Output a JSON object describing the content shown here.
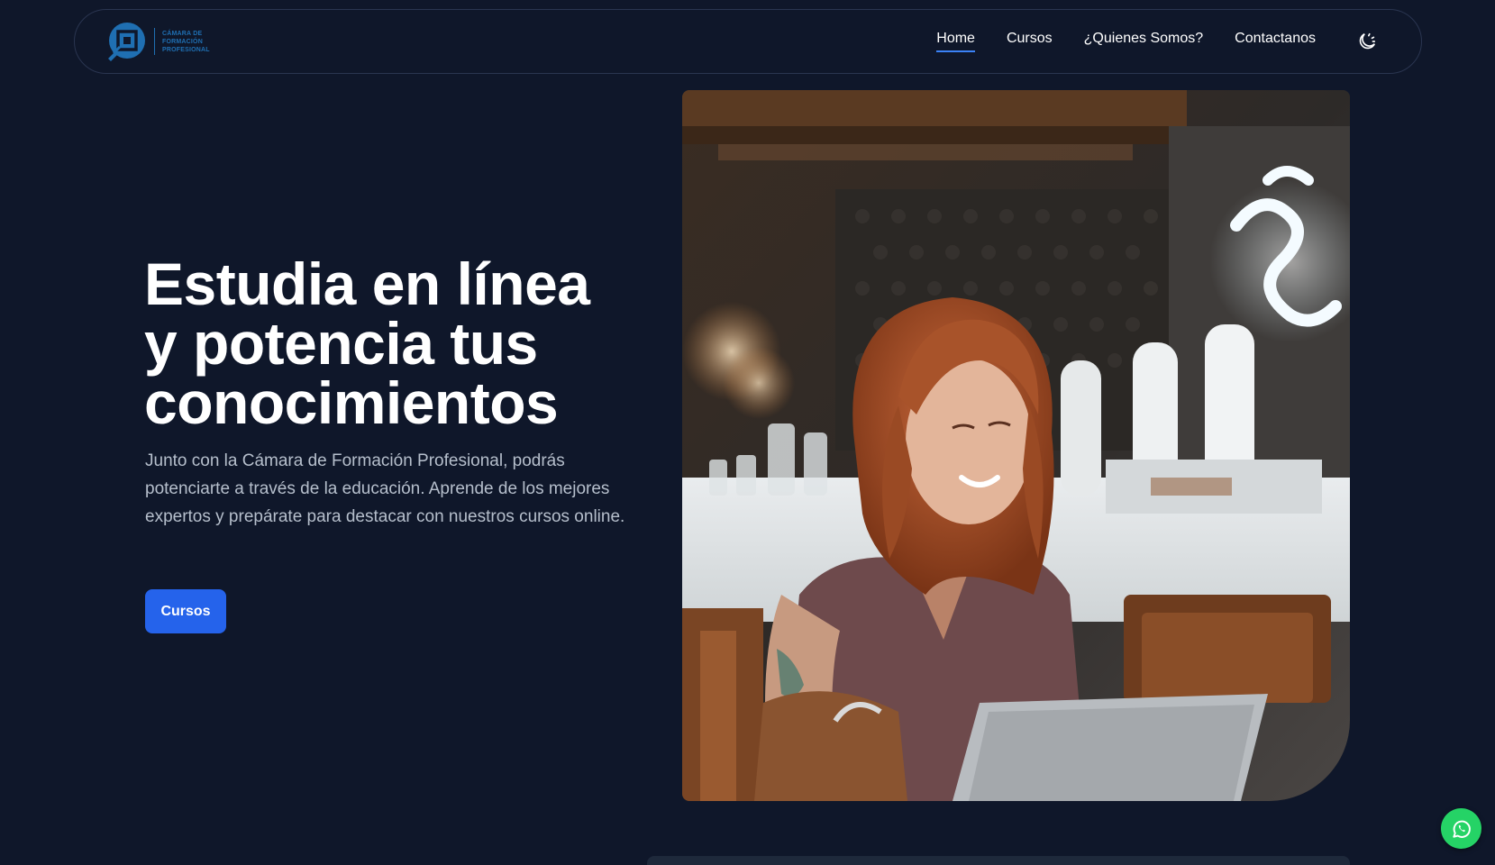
{
  "brand": {
    "logo_icon": "camara-logo-icon",
    "line1": "CÁMARA DE",
    "line2": "FORMACIÓN",
    "line3": "PROFESIONAL",
    "color": "#1f6fb2"
  },
  "nav": {
    "items": [
      {
        "label": "Home",
        "active": true
      },
      {
        "label": "Cursos",
        "active": false
      },
      {
        "label": "¿Quienes Somos?",
        "active": false
      },
      {
        "label": "Contactanos",
        "active": false
      }
    ],
    "theme_toggle_icon": "moon-icon"
  },
  "hero": {
    "title_line1": "Estudia en línea",
    "title_line2": "y potencia tus",
    "title_line3": "conocimientos",
    "description": "Junto con la Cámara de Formación Profesional, podrás potenciarte a través de la educación. Aprende de los mejores expertos y prepárate para destacar con nuestros cursos online.",
    "button_label": "Cursos",
    "image_icon": "woman-laptop-photo"
  },
  "floating": {
    "whatsapp_icon": "whatsapp-icon",
    "whatsapp_color": "#25d366"
  },
  "colors": {
    "background": "#0f172a",
    "accent": "#2563eb",
    "active_underline": "#3b82f6"
  }
}
